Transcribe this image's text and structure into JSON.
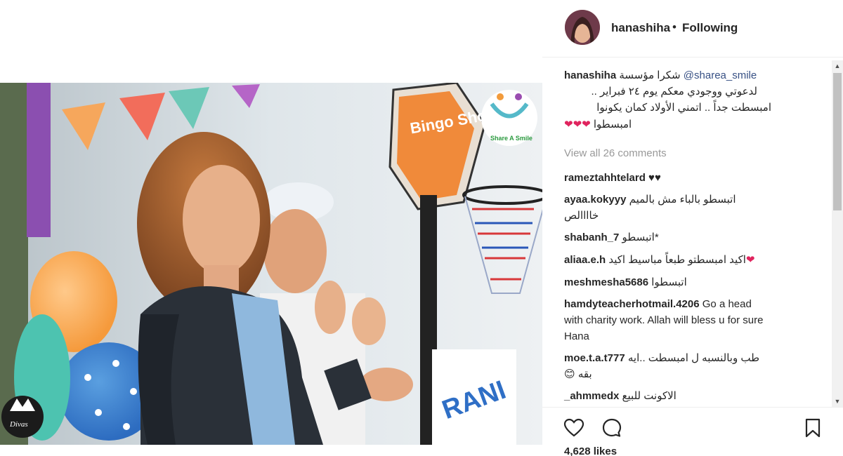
{
  "header": {
    "username": "hanashiha",
    "separator": "•",
    "follow_status": "Following"
  },
  "caption": {
    "username": "hanashiha",
    "text_line1_ar": "شكرا مؤسسة",
    "mention": "@sharea_smile",
    "text_line2": "لدعوتي ووجودي معكم يوم ٢٤ فبراير ..",
    "text_line3": "امبسطت جداً .. اتمني الأولاد كمان يكونوا",
    "text_line4": "امبسطوا",
    "hearts": "❤❤❤"
  },
  "view_all_comments": "View all 26 comments",
  "comments": [
    {
      "user": "rameztahhtelard",
      "text": "♥♥"
    },
    {
      "user": "ayaa.kokyyy",
      "text": "اتبسطو بالباء مش بالميم",
      "text2": "خاااالص"
    },
    {
      "user": "shabanh_7",
      "text": "اتبسطو*"
    },
    {
      "user": "aliaa.e.h",
      "text": "اكيد امبسطتو طبعاً مباسيط اكيد",
      "emoji": "❤"
    },
    {
      "user": "meshmesha5686",
      "text": "اتبسطوا"
    },
    {
      "user": "hamdyteacherhotmail.4206",
      "text": "Go a head",
      "text2": "with charity work. Allah will bless u for sure",
      "text3": "Hana"
    },
    {
      "user": "moe.t.a.t777",
      "text": "طب وبالنسبه ل امبسطت ..ايه",
      "text2": "بقه",
      "emoji": "😊"
    },
    {
      "user": "_ahmmedx",
      "text": "الاكونت للبيع"
    }
  ],
  "photo": {
    "logo_text": "Share A Smile",
    "hoop_text": "Bingo Shot",
    "watermark_text": "Divas",
    "brand_text": "RANI"
  },
  "likes": "4,628 likes",
  "icons": [
    "heart-icon",
    "comment-icon",
    "bookmark-icon"
  ],
  "colors": {
    "link": "#385185",
    "heart": "#e0245e",
    "muted": "#999999",
    "text": "#262626"
  }
}
